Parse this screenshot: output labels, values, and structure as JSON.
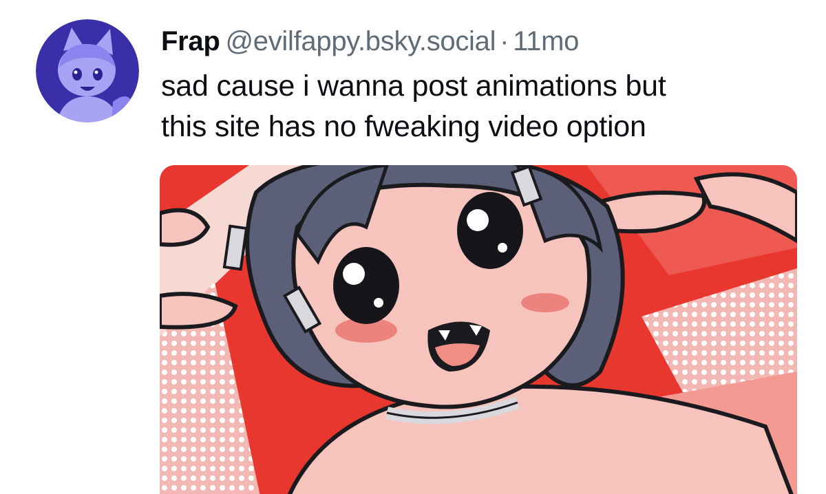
{
  "post": {
    "author": {
      "display_name": "Frap",
      "handle": "@evilfappy.bsky.social"
    },
    "separator": "·",
    "timestamp": "11mo",
    "text_lines": [
      "sad cause i wanna post animations but",
      "this site has no fweaking video option"
    ],
    "media": {
      "kind": "image",
      "description_icon": "anime-illustration-image"
    }
  },
  "colors": {
    "avatar_bg": "#3a2fa8",
    "avatar_figure": "#a9a3f5",
    "name": "#0b0f14",
    "meta": "#5f6b77",
    "media_red": "#e8372e",
    "media_skin": "#f6c4bd",
    "media_hair": "#5b6078"
  }
}
